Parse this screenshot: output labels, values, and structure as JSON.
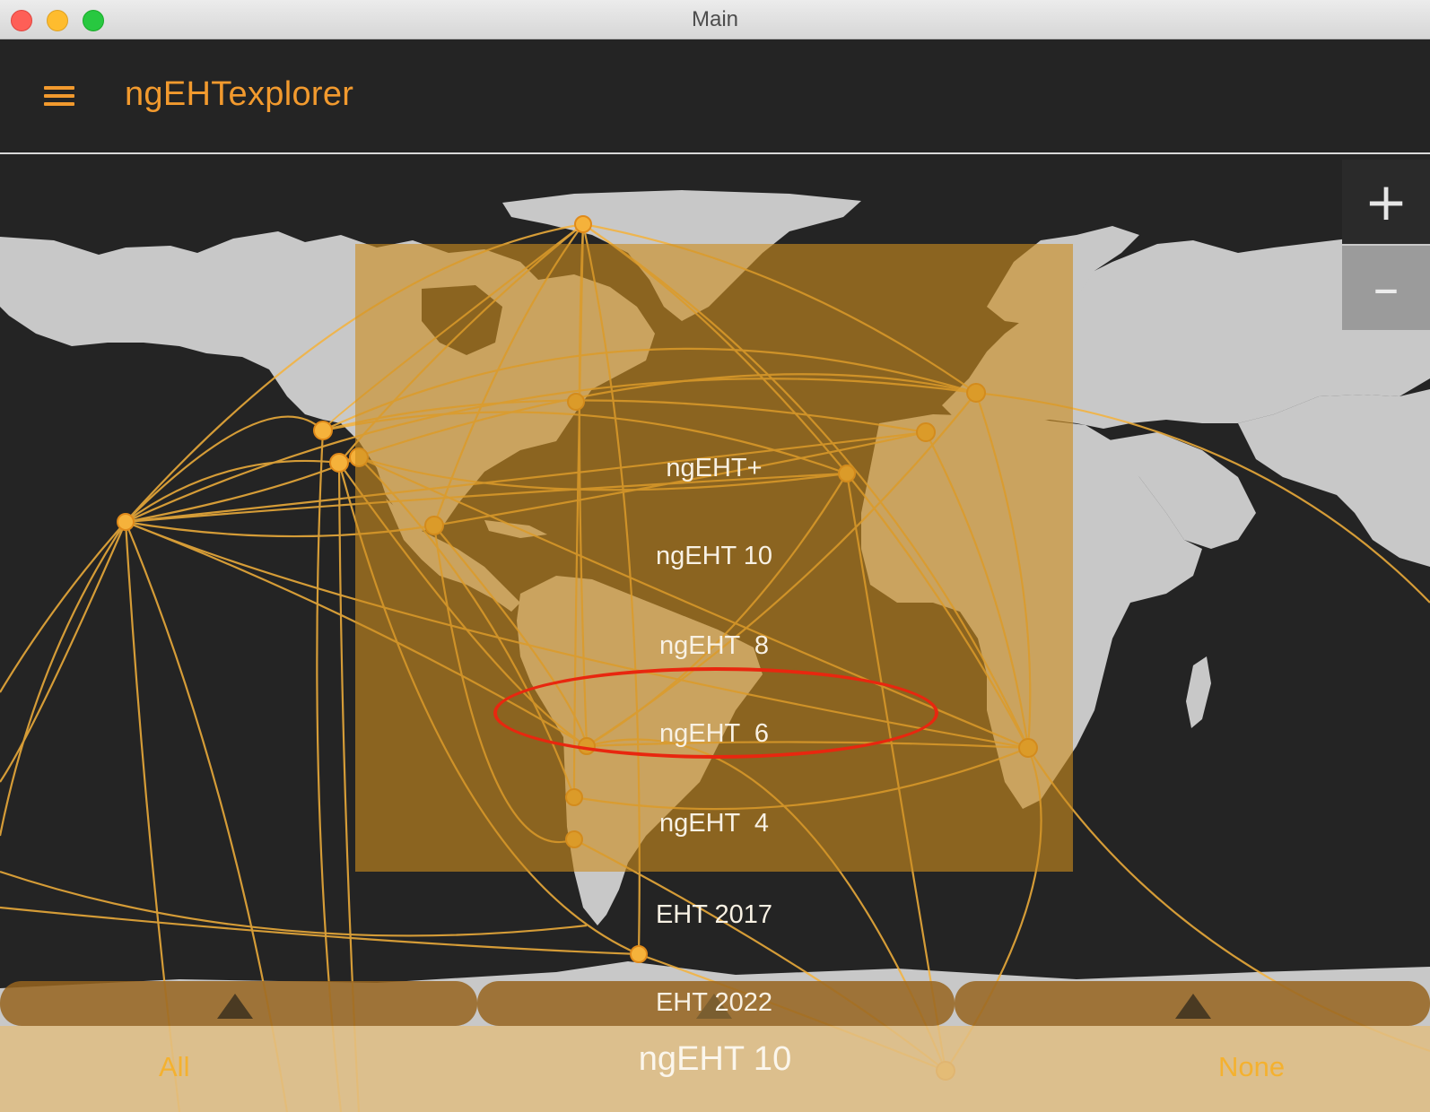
{
  "window": {
    "title": "Main"
  },
  "appbar": {
    "title": "ngEHTexplorer",
    "menu_icon": "hamburger-menu-icon"
  },
  "map": {
    "zoom_in_label": "+",
    "zoom_out_label": "–"
  },
  "array_selector": {
    "options": [
      "ngEHT+",
      "ngEHT 10",
      "ngEHT  8",
      "ngEHT  6",
      "ngEHT  4",
      "EHT 2017",
      "EHT 2022"
    ],
    "highlighted": "ngEHT  6",
    "selected": "ngEHT 10",
    "all_label": "All",
    "none_label": "None"
  },
  "colors": {
    "accent": "#f29a2e",
    "baseline": "#f5b23b",
    "land": "#c8c8c8",
    "ocean": "#242424",
    "highlight": "#e8270f"
  }
}
